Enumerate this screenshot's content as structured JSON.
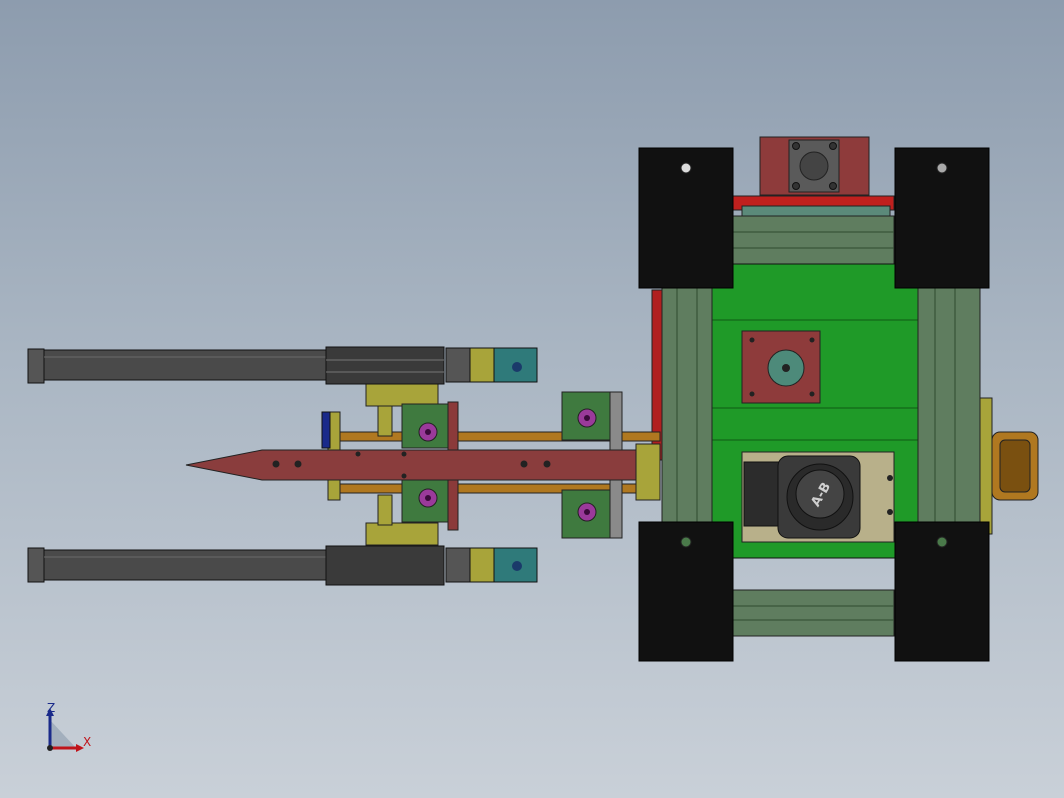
{
  "view": {
    "background_top": "#8d9cae",
    "background_bottom": "#c9d0d8"
  },
  "triad": {
    "z_label": "Z",
    "x_label": "X",
    "z_color": "#1a2a8a",
    "x_color": "#c0141b"
  },
  "motor_badge": {
    "text": "A-B"
  },
  "colors": {
    "wheel": "#111111",
    "chassis_green": "#1f9a28",
    "rail_green": "#5a7a5a",
    "plate_maroon": "#8b3a3a",
    "drill_body": "#8a3d3d",
    "cylinder": "#4a4a4a",
    "bracket_yellow": "#a8a43a",
    "bracket_green": "#3f7a3f",
    "bolt_purple": "#9a3a9a",
    "teal_block": "#2f7a7a",
    "orange_bar": "#b07820"
  }
}
